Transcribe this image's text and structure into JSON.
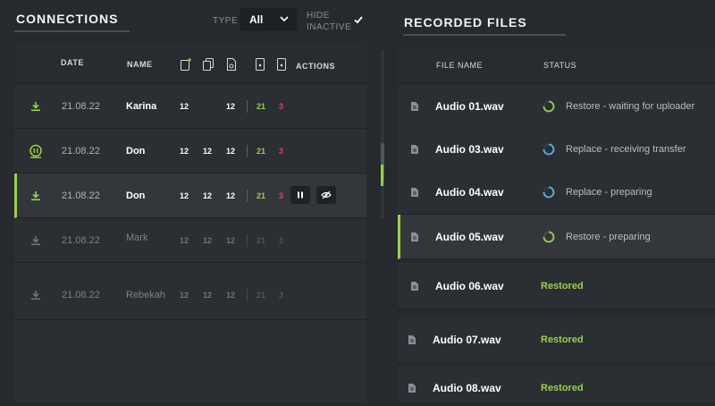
{
  "connections": {
    "title": "CONNECTIONS",
    "type_label": "TYPE",
    "type_value": "All",
    "hide_inactive_label_1": "HIDE",
    "hide_inactive_label_2": "INACTIVE",
    "columns": {
      "date": "DATE",
      "name": "NAME",
      "actions": "ACTIONS"
    },
    "rows": [
      {
        "date": "21.08.22",
        "name": "Karina",
        "n1": "12",
        "n2": "",
        "n3": "12",
        "ok": "21",
        "err": "3"
      },
      {
        "date": "21.08.22",
        "name": "Don",
        "n1": "12",
        "n2": "12",
        "n3": "12",
        "ok": "21",
        "err": "3"
      },
      {
        "date": "21.08.22",
        "name": "Don",
        "n1": "12",
        "n2": "12",
        "n3": "12",
        "ok": "21",
        "err": "3"
      },
      {
        "date": "21.08.22",
        "name": "Mark",
        "n1": "12",
        "n2": "12",
        "n3": "12",
        "ok": "21",
        "err": "3"
      },
      {
        "date": "21.08.22",
        "name": "Rebekah",
        "n1": "12",
        "n2": "12",
        "n3": "12",
        "ok": "21",
        "err": "3"
      }
    ]
  },
  "recorded": {
    "title": "RECORDED FILES",
    "columns": {
      "file_name": "FILE NAME",
      "status": "STATUS"
    },
    "files": [
      {
        "name": "Audio 01.wav",
        "status": "Restore - waiting for uploader"
      },
      {
        "name": "Audio 03.wav",
        "status": "Replace - receiving transfer"
      },
      {
        "name": "Audio 04.wav",
        "status": "Replace - preparing"
      },
      {
        "name": "Audio 05.wav",
        "status": "Restore - preparing"
      },
      {
        "name": "Audio 06.wav",
        "status": "Restored"
      },
      {
        "name": "Audio 07.wav",
        "status": "Restored"
      },
      {
        "name": "Audio 08.wav",
        "status": "Restored"
      }
    ]
  },
  "colors": {
    "accent": "#9ad04e",
    "error": "#e2484a",
    "progress_blue": "#5ab4e0",
    "background": "#26292e"
  }
}
